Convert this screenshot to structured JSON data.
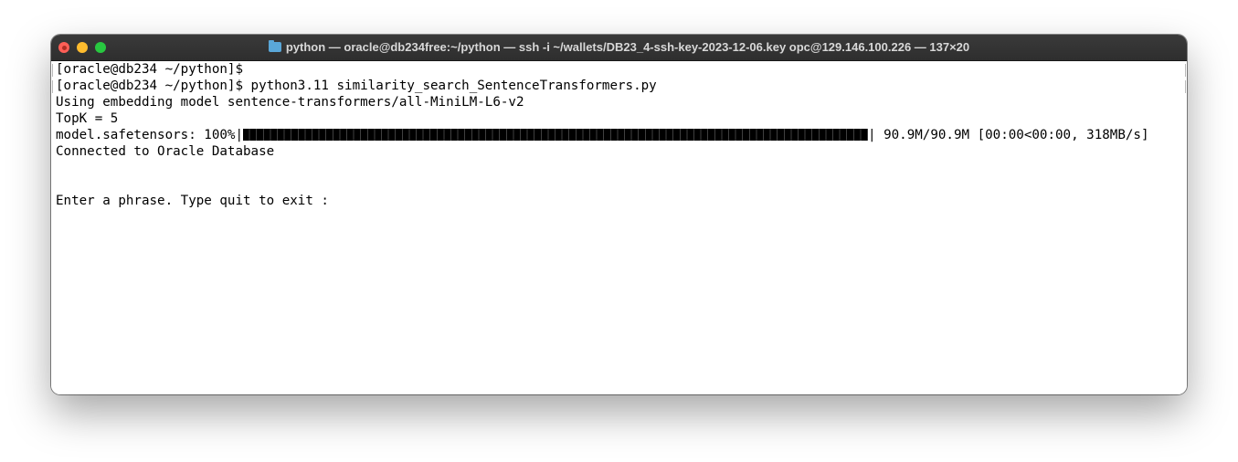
{
  "window": {
    "title": "python — oracle@db234free:~/python — ssh -i ~/wallets/DB23_4-ssh-key-2023-12-06.key opc@129.146.100.226 — 137×20"
  },
  "terminal": {
    "line1": "[oracle@db234 ~/python]$",
    "line2": "[oracle@db234 ~/python]$ python3.11 similarity_search_SentenceTransformers.py",
    "line3": "Using embedding model sentence-transformers/all-MiniLM-L6-v2",
    "line4": "TopK = 5",
    "progress": {
      "prefix": "model.safetensors: 100%|",
      "percent": 100,
      "suffix": "| 90.9M/90.9M [00:00<00:00, 318MB/s]"
    },
    "line6": "Connected to Oracle Database",
    "line8": "Enter a phrase. Type quit to exit :"
  },
  "colors": {
    "titlebar": "#2e2e2e",
    "close": "#ff5f57",
    "minimize": "#febc2e",
    "maximize": "#28c840",
    "folder": "#5aa7d8"
  }
}
